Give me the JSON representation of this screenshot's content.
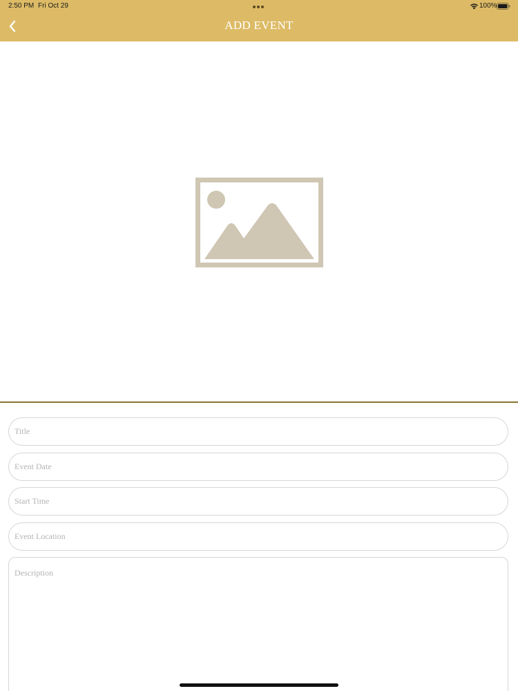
{
  "status_bar": {
    "time": "2:50 PM",
    "date": "Fri Oct 29",
    "battery": "100%"
  },
  "nav": {
    "title": "ADD EVENT"
  },
  "form": {
    "title_placeholder": "Title",
    "date_placeholder": "Event Date",
    "time_placeholder": "Start Time",
    "location_placeholder": "Event Location",
    "description_placeholder": "Description"
  },
  "icons": {
    "back": "chevron-left-icon",
    "placeholder": "image-placeholder-icon"
  },
  "colors": {
    "header": "#ddbb66",
    "divider": "#8a7430",
    "placeholder_icon": "#cfc6b3"
  }
}
